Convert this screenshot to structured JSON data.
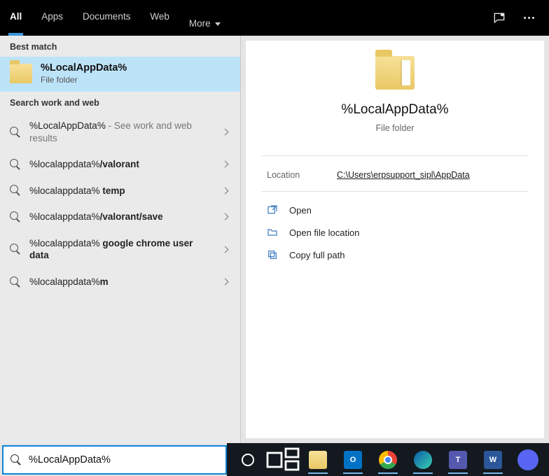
{
  "tabs": {
    "all": "All",
    "apps": "Apps",
    "documents": "Documents",
    "web": "Web",
    "more": "More"
  },
  "sections": {
    "best_match": "Best match",
    "search_ww": "Search work and web"
  },
  "best_match": {
    "title": "%LocalAppData%",
    "subtitle": "File folder"
  },
  "suggestions": [
    {
      "prefix": "%LocalAppData%",
      "bold": "",
      "suffix": " - See work and web results"
    },
    {
      "prefix": "%localappdata%",
      "bold": "/valorant",
      "suffix": ""
    },
    {
      "prefix": "%localappdata% ",
      "bold": "temp",
      "suffix": ""
    },
    {
      "prefix": "%localappdata%",
      "bold": "/valorant/save",
      "suffix": ""
    },
    {
      "prefix": "%localappdata% ",
      "bold": "google chrome user data",
      "suffix": ""
    },
    {
      "prefix": "%localappdata%",
      "bold": "m",
      "suffix": ""
    }
  ],
  "preview": {
    "title": "%LocalAppData%",
    "subtitle": "File folder",
    "location_label": "Location",
    "location_value": "C:\\Users\\erpsupport_sipl\\AppData",
    "actions": {
      "open": "Open",
      "open_loc": "Open file location",
      "copy_path": "Copy full path"
    }
  },
  "search_input": "%LocalAppData%"
}
